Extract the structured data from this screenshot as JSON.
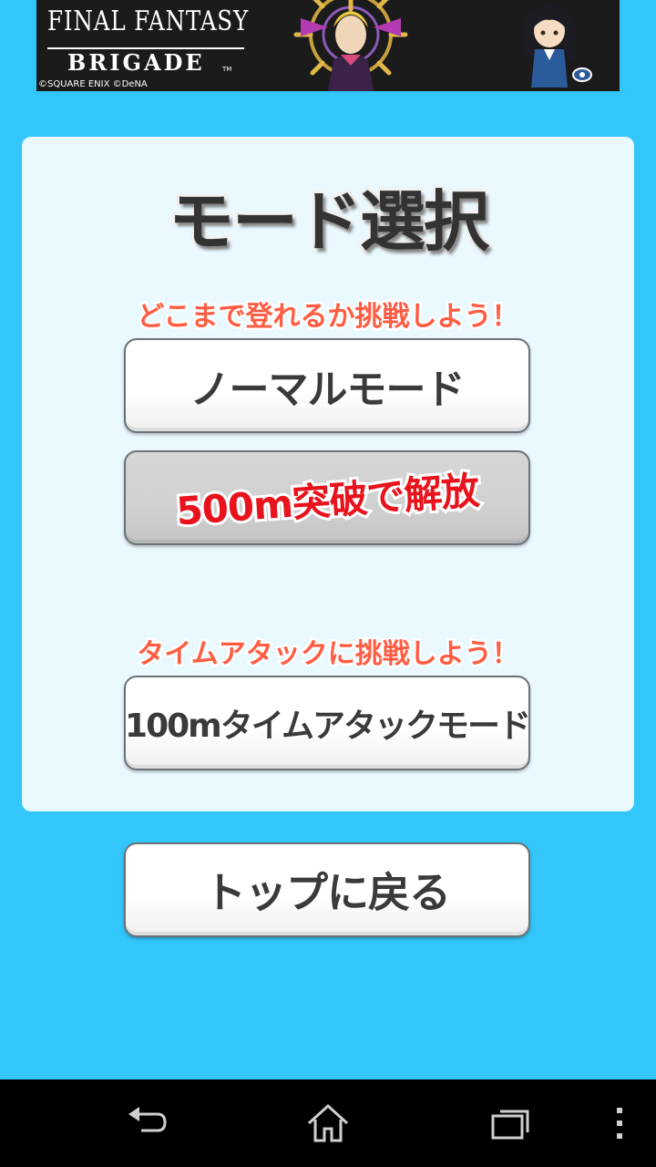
{
  "ad_banner": {
    "logo_line1": "FINAL FANTASY",
    "logo_line2": "BRIGADE",
    "trademark": "TM",
    "copyright": "©SQUARE ENIX  ©DeNA"
  },
  "mode_select": {
    "title": "モード選択",
    "normal_caption": "どこまで登れるか挑戦しよう！",
    "normal_button_label": "ノーマルモード",
    "locked_button_label": "500m突破で解放",
    "time_attack_caption": "タイムアタックに挑戦しよう！",
    "time_attack_button_label": "100mタイムアタックモード"
  },
  "back_button_label": "トップに戻る",
  "navigation_bar": {
    "icons": [
      "back-icon",
      "home-icon",
      "recent-apps-icon",
      "overflow-menu-icon"
    ]
  },
  "colors": {
    "background": "#33c6fb",
    "panel": "#e9f9ff",
    "caption": "#ff5d43",
    "locked_text": "#e8131c",
    "button_text": "#3a3a3a"
  }
}
